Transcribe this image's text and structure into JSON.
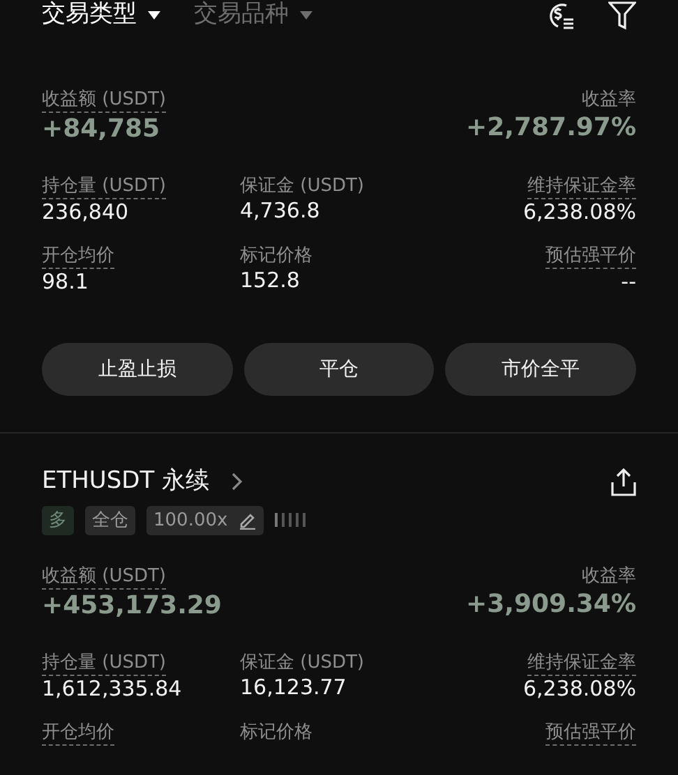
{
  "filters": [
    {
      "label": "交易类型",
      "selected": true
    },
    {
      "label": "交易品种",
      "selected": false
    }
  ],
  "positions": [
    {
      "pnl": {
        "label": "收益额 (USDT)",
        "value": "+84,785",
        "underlined": true
      },
      "rate": {
        "label": "收益率",
        "value": "+2,787.97%",
        "underlined": false
      },
      "fields": [
        {
          "label": "持仓量 (USDT)",
          "value": "236,840",
          "underlined": true
        },
        {
          "label": "保证金 (USDT)",
          "value": "4,736.8",
          "underlined": false
        },
        {
          "label": "维持保证金率",
          "value": "6,238.08%",
          "underlined": true
        },
        {
          "label": "开仓均价",
          "value": "98.1",
          "underlined": true
        },
        {
          "label": "标记价格",
          "value": "152.8",
          "underlined": false
        },
        {
          "label": "预估强平价",
          "value": "--",
          "underlined": true
        }
      ],
      "buttons": [
        "止盈止损",
        "平仓",
        "市价全平"
      ]
    },
    {
      "title": "ETHUSDT 永续",
      "tags": [
        {
          "text": "多",
          "kind": "side"
        },
        {
          "text": "全仓",
          "kind": "mode"
        },
        {
          "text": "100.00x",
          "kind": "leverage"
        }
      ],
      "pnl": {
        "label": "收益额 (USDT)",
        "value": "+453,173.29",
        "underlined": true
      },
      "rate": {
        "label": "收益率",
        "value": "+3,909.34%",
        "underlined": false
      },
      "fields": [
        {
          "label": "持仓量 (USDT)",
          "value": "1,612,335.84",
          "underlined": true
        },
        {
          "label": "保证金 (USDT)",
          "value": "16,123.77",
          "underlined": false
        },
        {
          "label": "维持保证金率",
          "value": "6,238.08%",
          "underlined": true
        },
        {
          "label": "开仓均价",
          "underlined": true
        },
        {
          "label": "标记价格",
          "underlined": false
        },
        {
          "label": "预估强平价",
          "underlined": true
        }
      ]
    }
  ]
}
